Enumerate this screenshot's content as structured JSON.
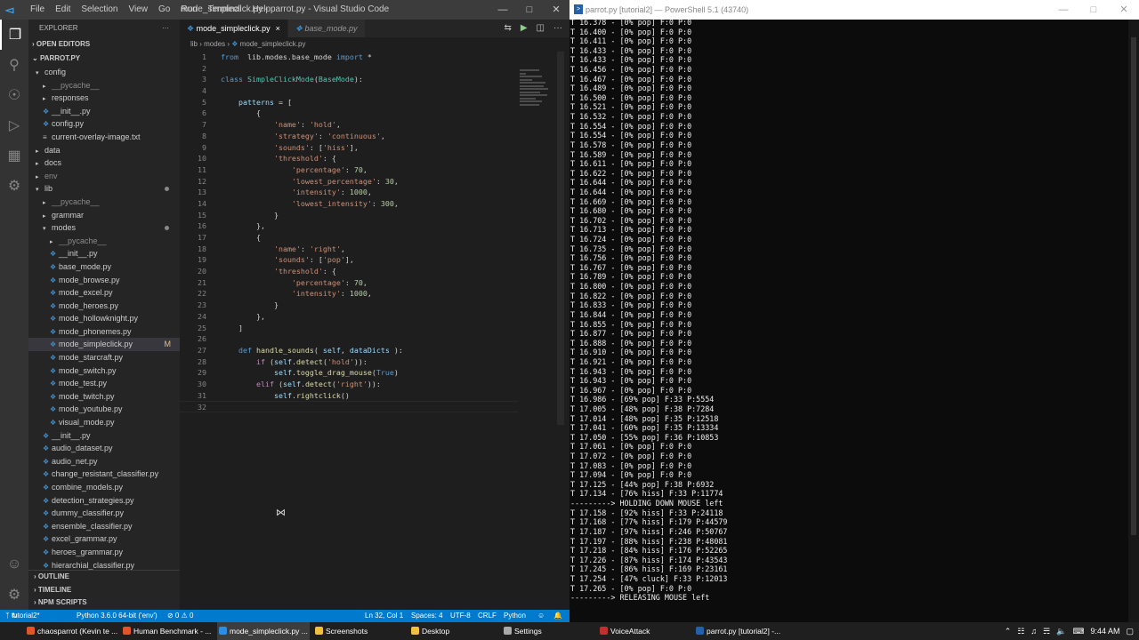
{
  "vscode": {
    "menu": [
      "File",
      "Edit",
      "Selection",
      "View",
      "Go",
      "Run",
      "Terminal",
      "Help"
    ],
    "window_title": "mode_simpleclick.py - parrot.py - Visual Studio Code",
    "explorer": {
      "title": "EXPLORER",
      "open_editors": "OPEN EDITORS",
      "project": "PARROT.PY",
      "items": [
        {
          "label": "config",
          "indent": 1,
          "kind": "folder-open"
        },
        {
          "label": "__pycache__",
          "indent": 2,
          "kind": "folder",
          "dim": true
        },
        {
          "label": "responses",
          "indent": 2,
          "kind": "folder"
        },
        {
          "label": "__init__.py",
          "indent": 2,
          "kind": "file"
        },
        {
          "label": "config.py",
          "indent": 2,
          "kind": "file"
        },
        {
          "label": "current-overlay-image.txt",
          "indent": 2,
          "kind": "text"
        },
        {
          "label": "data",
          "indent": 1,
          "kind": "folder"
        },
        {
          "label": "docs",
          "indent": 1,
          "kind": "folder"
        },
        {
          "label": "env",
          "indent": 1,
          "kind": "folder",
          "dim": true
        },
        {
          "label": "lib",
          "indent": 1,
          "kind": "folder-open",
          "dot": true
        },
        {
          "label": "__pycache__",
          "indent": 2,
          "kind": "folder",
          "dim": true
        },
        {
          "label": "grammar",
          "indent": 2,
          "kind": "folder"
        },
        {
          "label": "modes",
          "indent": 2,
          "kind": "folder-open",
          "dot": true
        },
        {
          "label": "__pycache__",
          "indent": 3,
          "kind": "folder",
          "dim": true
        },
        {
          "label": "__init__.py",
          "indent": 3,
          "kind": "file"
        },
        {
          "label": "base_mode.py",
          "indent": 3,
          "kind": "file"
        },
        {
          "label": "mode_browse.py",
          "indent": 3,
          "kind": "file"
        },
        {
          "label": "mode_excel.py",
          "indent": 3,
          "kind": "file"
        },
        {
          "label": "mode_heroes.py",
          "indent": 3,
          "kind": "file"
        },
        {
          "label": "mode_hollowknight.py",
          "indent": 3,
          "kind": "file"
        },
        {
          "label": "mode_phonemes.py",
          "indent": 3,
          "kind": "file"
        },
        {
          "label": "mode_simpleclick.py",
          "indent": 3,
          "kind": "file",
          "selected": true,
          "mod": "M"
        },
        {
          "label": "mode_starcraft.py",
          "indent": 3,
          "kind": "file"
        },
        {
          "label": "mode_switch.py",
          "indent": 3,
          "kind": "file"
        },
        {
          "label": "mode_test.py",
          "indent": 3,
          "kind": "file"
        },
        {
          "label": "mode_twitch.py",
          "indent": 3,
          "kind": "file"
        },
        {
          "label": "mode_youtube.py",
          "indent": 3,
          "kind": "file"
        },
        {
          "label": "visual_mode.py",
          "indent": 3,
          "kind": "file"
        },
        {
          "label": "__init__.py",
          "indent": 2,
          "kind": "file"
        },
        {
          "label": "audio_dataset.py",
          "indent": 2,
          "kind": "file"
        },
        {
          "label": "audio_net.py",
          "indent": 2,
          "kind": "file"
        },
        {
          "label": "change_resistant_classifier.py",
          "indent": 2,
          "kind": "file"
        },
        {
          "label": "combine_models.py",
          "indent": 2,
          "kind": "file"
        },
        {
          "label": "detection_strategies.py",
          "indent": 2,
          "kind": "file"
        },
        {
          "label": "dummy_classifier.py",
          "indent": 2,
          "kind": "file"
        },
        {
          "label": "ensemble_classifier.py",
          "indent": 2,
          "kind": "file"
        },
        {
          "label": "excel_grammar.py",
          "indent": 2,
          "kind": "file"
        },
        {
          "label": "heroes_grammar.py",
          "indent": 2,
          "kind": "file"
        },
        {
          "label": "hierarchial_classifier.py",
          "indent": 2,
          "kind": "file"
        }
      ],
      "bottom_sections": [
        "OUTLINE",
        "TIMELINE",
        "NPM SCRIPTS"
      ]
    },
    "tabs": [
      {
        "label": "mode_simpleclick.py",
        "active": true,
        "close": "×"
      },
      {
        "label": "base_mode.py",
        "active": false
      }
    ],
    "breadcrumb": [
      "lib",
      "modes",
      "mode_simpleclick.py"
    ],
    "code_lines": [
      [
        [
          "kw",
          "from"
        ],
        [
          "",
          "  lib.modes.base_mode "
        ],
        [
          "kw",
          "import"
        ],
        [
          "",
          " *"
        ]
      ],
      [],
      [
        [
          "kw",
          "class"
        ],
        [
          "",
          " "
        ],
        [
          "cls",
          "SimpleClickMode"
        ],
        [
          "",
          "("
        ],
        [
          "cls",
          "BaseMode"
        ],
        [
          "",
          "):"
        ]
      ],
      [],
      [
        [
          "",
          "    "
        ],
        [
          "var",
          "patterns"
        ],
        [
          "",
          " = ["
        ]
      ],
      [
        [
          "",
          "        {"
        ]
      ],
      [
        [
          "",
          "            "
        ],
        [
          "str",
          "'name'"
        ],
        [
          "",
          ": "
        ],
        [
          "str",
          "'hold'"
        ],
        [
          "",
          ","
        ]
      ],
      [
        [
          "",
          "            "
        ],
        [
          "str",
          "'strategy'"
        ],
        [
          "",
          ": "
        ],
        [
          "str",
          "'continuous'"
        ],
        [
          "",
          ","
        ]
      ],
      [
        [
          "",
          "            "
        ],
        [
          "str",
          "'sounds'"
        ],
        [
          "",
          ": ["
        ],
        [
          "str",
          "'hiss'"
        ],
        [
          "",
          "],"
        ]
      ],
      [
        [
          "",
          "            "
        ],
        [
          "str",
          "'threshold'"
        ],
        [
          "",
          ": {"
        ]
      ],
      [
        [
          "",
          "                "
        ],
        [
          "str",
          "'percentage'"
        ],
        [
          "",
          ": "
        ],
        [
          "num",
          "70"
        ],
        [
          "",
          ","
        ]
      ],
      [
        [
          "",
          "                "
        ],
        [
          "str",
          "'lowest_percentage'"
        ],
        [
          "",
          ": "
        ],
        [
          "num",
          "30"
        ],
        [
          "",
          ","
        ]
      ],
      [
        [
          "",
          "                "
        ],
        [
          "str",
          "'intensity'"
        ],
        [
          "",
          ": "
        ],
        [
          "num",
          "1000"
        ],
        [
          "",
          ","
        ]
      ],
      [
        [
          "",
          "                "
        ],
        [
          "str",
          "'lowest_intensity'"
        ],
        [
          "",
          ": "
        ],
        [
          "num",
          "300"
        ],
        [
          "",
          ","
        ]
      ],
      [
        [
          "",
          "            }"
        ]
      ],
      [
        [
          "",
          "        },"
        ]
      ],
      [
        [
          "",
          "        {"
        ]
      ],
      [
        [
          "",
          "            "
        ],
        [
          "str",
          "'name'"
        ],
        [
          "",
          ": "
        ],
        [
          "str",
          "'right'"
        ],
        [
          "",
          ","
        ]
      ],
      [
        [
          "",
          "            "
        ],
        [
          "str",
          "'sounds'"
        ],
        [
          "",
          ": ["
        ],
        [
          "str",
          "'pop'"
        ],
        [
          "",
          "],"
        ]
      ],
      [
        [
          "",
          "            "
        ],
        [
          "str",
          "'threshold'"
        ],
        [
          "",
          ": {"
        ]
      ],
      [
        [
          "",
          "                "
        ],
        [
          "str",
          "'percentage'"
        ],
        [
          "",
          ": "
        ],
        [
          "num",
          "70"
        ],
        [
          "",
          ","
        ]
      ],
      [
        [
          "",
          "                "
        ],
        [
          "str",
          "'intensity'"
        ],
        [
          "",
          ": "
        ],
        [
          "num",
          "1000"
        ],
        [
          "",
          ","
        ]
      ],
      [
        [
          "",
          "            }"
        ]
      ],
      [
        [
          "",
          "        },"
        ]
      ],
      [
        [
          "",
          "    ]"
        ]
      ],
      [],
      [
        [
          "",
          "    "
        ],
        [
          "kw",
          "def"
        ],
        [
          "",
          " "
        ],
        [
          "fn",
          "handle_sounds"
        ],
        [
          "",
          "( "
        ],
        [
          "var",
          "self"
        ],
        [
          "",
          ", "
        ],
        [
          "var",
          "dataDicts"
        ],
        [
          "",
          " ):"
        ]
      ],
      [
        [
          "",
          "        "
        ],
        [
          "ctrl",
          "if"
        ],
        [
          "",
          " ("
        ],
        [
          "var",
          "self"
        ],
        [
          "",
          "."
        ],
        [
          "fn",
          "detect"
        ],
        [
          "",
          "("
        ],
        [
          "str",
          "'hold'"
        ],
        [
          "",
          ")):"
        ]
      ],
      [
        [
          "",
          "            "
        ],
        [
          "var",
          "self"
        ],
        [
          "",
          "."
        ],
        [
          "fn",
          "toggle_drag_mouse"
        ],
        [
          "",
          "("
        ],
        [
          "kw",
          "True"
        ],
        [
          "",
          ")"
        ]
      ],
      [
        [
          "",
          "        "
        ],
        [
          "ctrl",
          "elif"
        ],
        [
          "",
          " ("
        ],
        [
          "var",
          "self"
        ],
        [
          "",
          "."
        ],
        [
          "fn",
          "detect"
        ],
        [
          "",
          "("
        ],
        [
          "str",
          "'right'"
        ],
        [
          "",
          ")):"
        ]
      ],
      [
        [
          "",
          "            "
        ],
        [
          "var",
          "self"
        ],
        [
          "",
          "."
        ],
        [
          "fn",
          "rightclick"
        ],
        [
          "",
          "()"
        ]
      ],
      []
    ],
    "status": {
      "branch": "tutorial2*",
      "python": "Python 3.6.0 64-bit ('env')",
      "problems": "⊘ 0 ⚠ 0",
      "position": "Ln 32, Col 1",
      "spaces": "Spaces: 4",
      "encoding": "UTF-8",
      "eol": "CRLF",
      "language": "Python"
    }
  },
  "terminal": {
    "title": "parrot.py [tutorial2] — PowerShell 5.1 (43740)",
    "lines": [
      "T 16.378 - [0% pop] F:0 P:0",
      "T 16.400 - [0% pop] F:0 P:0",
      "T 16.411 - [0% pop] F:0 P:0",
      "T 16.433 - [0% pop] F:0 P:0",
      "T 16.433 - [0% pop] F:0 P:0",
      "T 16.456 - [0% pop] F:0 P:0",
      "T 16.467 - [0% pop] F:0 P:0",
      "T 16.489 - [0% pop] F:0 P:0",
      "T 16.500 - [0% pop] F:0 P:0",
      "T 16.521 - [0% pop] F:0 P:0",
      "T 16.532 - [0% pop] F:0 P:0",
      "T 16.554 - [0% pop] F:0 P:0",
      "T 16.554 - [0% pop] F:0 P:0",
      "T 16.578 - [0% pop] F:0 P:0",
      "T 16.589 - [0% pop] F:0 P:0",
      "T 16.611 - [0% pop] F:0 P:0",
      "T 16.622 - [0% pop] F:0 P:0",
      "T 16.644 - [0% pop] F:0 P:0",
      "T 16.644 - [0% pop] F:0 P:0",
      "T 16.669 - [0% pop] F:0 P:0",
      "T 16.680 - [0% pop] F:0 P:0",
      "T 16.702 - [0% pop] F:0 P:0",
      "T 16.713 - [0% pop] F:0 P:0",
      "T 16.724 - [0% pop] F:0 P:0",
      "T 16.735 - [0% pop] F:0 P:0",
      "T 16.756 - [0% pop] F:0 P:0",
      "T 16.767 - [0% pop] F:0 P:0",
      "T 16.789 - [0% pop] F:0 P:0",
      "T 16.800 - [0% pop] F:0 P:0",
      "T 16.822 - [0% pop] F:0 P:0",
      "T 16.833 - [0% pop] F:0 P:0",
      "T 16.844 - [0% pop] F:0 P:0",
      "T 16.855 - [0% pop] F:0 P:0",
      "T 16.877 - [0% pop] F:0 P:0",
      "T 16.888 - [0% pop] F:0 P:0",
      "T 16.910 - [0% pop] F:0 P:0",
      "T 16.921 - [0% pop] F:0 P:0",
      "T 16.943 - [0% pop] F:0 P:0",
      "T 16.943 - [0% pop] F:0 P:0",
      "T 16.967 - [0% pop] F:0 P:0",
      "T 16.986 - [69% pop] F:33 P:5554",
      "T 17.005 - [48% pop] F:38 P:7284",
      "T 17.014 - [48% pop] F:35 P:12518",
      "T 17.041 - [60% pop] F:35 P:13334",
      "T 17.050 - [55% pop] F:36 P:10853",
      "T 17.061 - [0% pop] F:0 P:0",
      "T 17.072 - [0% pop] F:0 P:0",
      "T 17.083 - [0% pop] F:0 P:0",
      "T 17.094 - [0% pop] F:0 P:0",
      "T 17.125 - [44% pop] F:38 P:6932",
      "T 17.134 - [76% hiss] F:33 P:11774",
      "---------> HOLDING DOWN MOUSE left",
      "T 17.158 - [92% hiss] F:33 P:24118",
      "T 17.168 - [77% hiss] F:179 P:44579",
      "T 17.187 - [97% hiss] F:246 P:50767",
      "T 17.197 - [88% hiss] F:238 P:48081",
      "T 17.218 - [84% hiss] F:176 P:52265",
      "T 17.226 - [87% hiss] F:174 P:43543",
      "T 17.245 - [86% hiss] F:169 P:23161",
      "T 17.254 - [47% cluck] F:33 P:12013",
      "T 17.265 - [0% pop] F:0 P:0",
      "---------> RELEASING MOUSE left"
    ]
  },
  "taskbar": {
    "items": [
      {
        "label": "chaosparrot (Kevin te ...",
        "color": "#e2542b"
      },
      {
        "label": "Human Benchmark - ...",
        "color": "#e2542b"
      },
      {
        "label": "mode_simpleclick.py ...",
        "color": "#2e8de0",
        "active": true
      },
      {
        "label": "Screenshots",
        "color": "#f0c040"
      },
      {
        "label": "Desktop",
        "color": "#f0c040"
      },
      {
        "label": "Settings",
        "color": "#aaaaaa"
      },
      {
        "label": "VoiceAttack",
        "color": "#c03030"
      },
      {
        "label": "parrot.py [tutorial2] -...",
        "color": "#2461a8"
      }
    ],
    "time": "9:44 AM"
  }
}
